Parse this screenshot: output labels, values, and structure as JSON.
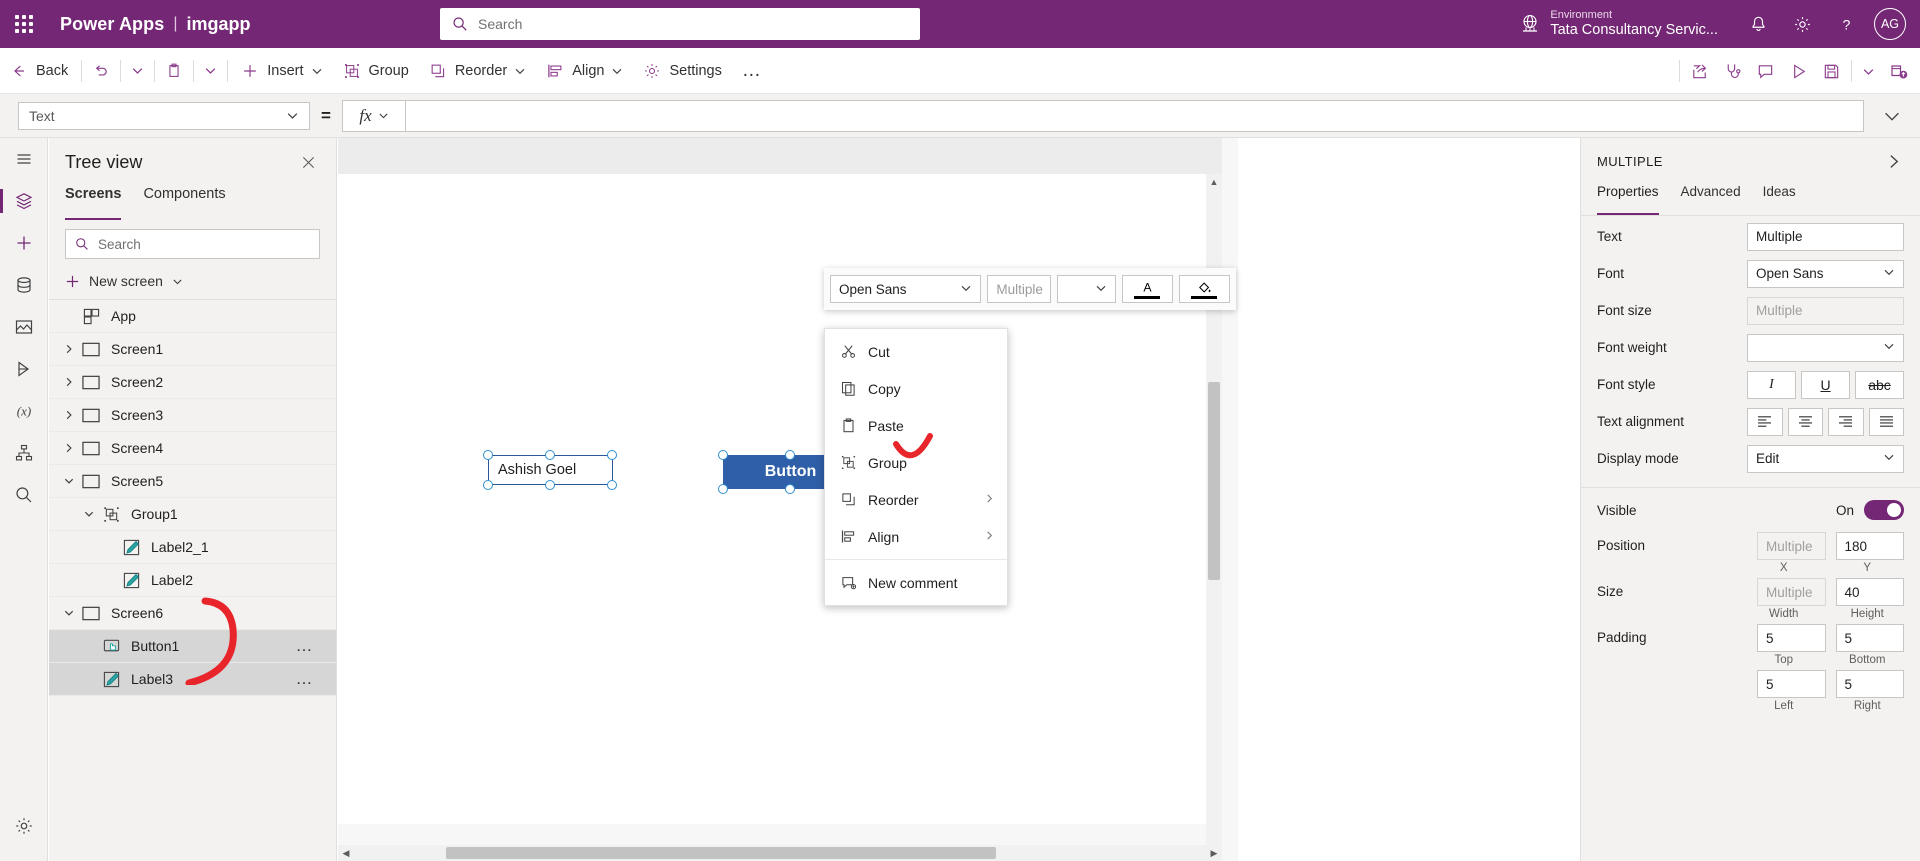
{
  "brand": {
    "waffle_icon": "waffle-icon",
    "product": "Power Apps",
    "separator": "|",
    "app_name": "imgapp",
    "search_placeholder": "Search",
    "environment_label": "Environment",
    "environment_name": "Tata Consultancy Servic...",
    "notification_icon": "bell-icon",
    "settings_icon": "gear-icon",
    "help_icon": "question-icon",
    "avatar_initials": "AG"
  },
  "commandbar": {
    "back": "Back",
    "undo_icon": "undo-icon",
    "undo_chevron": "chevron-down-icon",
    "paste_icon": "clipboard-icon",
    "paste_chevron": "chevron-down-icon",
    "insert": "Insert",
    "group": "Group",
    "reorder": "Reorder",
    "align": "Align",
    "settings": "Settings",
    "overflow": "…",
    "right_icons": [
      "share-icon",
      "app-checker-icon",
      "comments-icon",
      "play-icon",
      "save-icon",
      "chevron-down-icon",
      "publish-icon"
    ]
  },
  "formulabar": {
    "property": "Text",
    "equals": "=",
    "fx_label": "fx",
    "fx_chevron": "chevron-down-icon",
    "formula_value": "",
    "expand_icon": "chevron-down-icon"
  },
  "rail": {
    "items": [
      "menu-icon",
      "layers-icon",
      "insert-icon",
      "data-icon",
      "media-icon",
      "flows-icon",
      "variables-icon",
      "tree-icon",
      "search-icon"
    ],
    "bottom_items": [
      "settings-gear-icon"
    ]
  },
  "treeview": {
    "title": "Tree view",
    "close_icon": "close-icon",
    "tabs": [
      {
        "label": "Screens",
        "active": true
      },
      {
        "label": "Components",
        "active": false
      }
    ],
    "search_placeholder": "Search",
    "search_icon": "search-icon",
    "new_screen": "New screen",
    "new_screen_chevron": "chevron-down-icon",
    "rows": [
      {
        "name": "App",
        "icon": "app-icon",
        "twisty": "",
        "indent": 0,
        "selected": false,
        "dots": false
      },
      {
        "name": "Screen1",
        "icon": "screen-icon",
        "twisty": "collapsed",
        "indent": 0,
        "selected": false,
        "dots": false
      },
      {
        "name": "Screen2",
        "icon": "screen-icon",
        "twisty": "collapsed",
        "indent": 0,
        "selected": false,
        "dots": false
      },
      {
        "name": "Screen3",
        "icon": "screen-icon",
        "twisty": "collapsed",
        "indent": 0,
        "selected": false,
        "dots": false
      },
      {
        "name": "Screen4",
        "icon": "screen-icon",
        "twisty": "collapsed",
        "indent": 0,
        "selected": false,
        "dots": false
      },
      {
        "name": "Screen5",
        "icon": "screen-icon",
        "twisty": "expanded",
        "indent": 0,
        "selected": false,
        "dots": false
      },
      {
        "name": "Group1",
        "icon": "group-icon",
        "twisty": "expanded",
        "indent": 1,
        "selected": false,
        "dots": false
      },
      {
        "name": "Label2_1",
        "icon": "label-icon",
        "twisty": "",
        "indent": 2,
        "selected": false,
        "dots": false
      },
      {
        "name": "Label2",
        "icon": "label-icon",
        "twisty": "",
        "indent": 2,
        "selected": false,
        "dots": false
      },
      {
        "name": "Screen6",
        "icon": "screen-icon",
        "twisty": "expanded",
        "indent": 0,
        "selected": false,
        "dots": false
      },
      {
        "name": "Button1",
        "icon": "button-icon",
        "twisty": "",
        "indent": 1,
        "selected": true,
        "dots": true
      },
      {
        "name": "Label3",
        "icon": "label-icon",
        "twisty": "",
        "indent": 1,
        "selected": true,
        "dots": true
      }
    ]
  },
  "canvas": {
    "label_control_text": "Ashish Goel",
    "button_control_text": "Button",
    "scroll_up_icon": "caret-up-icon",
    "scroll_down_icon": "caret-down-icon",
    "scroll_left_icon": "caret-left-icon",
    "scroll_right_icon": "caret-right-icon"
  },
  "mini_toolbar": {
    "font_value": "Open Sans",
    "font_chevron": "chevron-down-icon",
    "size_placeholder": "Multiple",
    "size_value": "",
    "weight_value": "",
    "weight_chevron": "chevron-down-icon",
    "font_color_icon": "font-color-icon",
    "fill_color_icon": "fill-color-icon"
  },
  "context_menu": {
    "items": [
      {
        "label": "Cut",
        "icon": "scissors-icon",
        "submenu": false
      },
      {
        "label": "Copy",
        "icon": "copy-icon",
        "submenu": false
      },
      {
        "label": "Paste",
        "icon": "clipboard-icon",
        "submenu": false
      },
      {
        "label": "Group",
        "icon": "group-icon",
        "submenu": false
      },
      {
        "label": "Reorder",
        "icon": "reorder-icon",
        "submenu": true
      },
      {
        "label": "Align",
        "icon": "align-icon",
        "submenu": true
      },
      {
        "label": "New comment",
        "icon": "comment-icon",
        "submenu": false
      }
    ]
  },
  "properties": {
    "header": "MULTIPLE",
    "collapse_icon": "chevron-right-icon",
    "tabs": [
      {
        "label": "Properties",
        "active": true
      },
      {
        "label": "Advanced",
        "active": false
      },
      {
        "label": "Ideas",
        "active": false
      }
    ],
    "text_label": "Text",
    "text_value": "Multiple",
    "font_label": "Font",
    "font_value": "Open Sans",
    "font_size_label": "Font size",
    "font_size_placeholder": "Multiple",
    "font_size_value": "",
    "font_weight_label": "Font weight",
    "font_weight_value": "",
    "font_style_label": "Font style",
    "font_style_buttons": [
      "italic-icon",
      "underline-icon",
      "strikethrough-icon"
    ],
    "text_alignment_label": "Text alignment",
    "text_alignment_buttons": [
      "align-left-icon",
      "align-center-icon",
      "align-right-icon",
      "align-justify-icon"
    ],
    "display_mode_label": "Display mode",
    "display_mode_value": "Edit",
    "visible_label": "Visible",
    "visible_state": "On",
    "position_label": "Position",
    "position_x_placeholder": "Multiple",
    "position_x_value": "",
    "position_y_value": "180",
    "position_cap_x": "X",
    "position_cap_y": "Y",
    "size_label": "Size",
    "size_w_placeholder": "Multiple",
    "size_w_value": "",
    "size_h_value": "40",
    "size_cap_w": "Width",
    "size_cap_h": "Height",
    "padding_label": "Padding",
    "padding_top": "5",
    "padding_bottom": "5",
    "padding_cap_top": "Top",
    "padding_cap_bottom": "Bottom",
    "padding_left": "5",
    "padding_right": "5",
    "padding_cap_left": "Left",
    "padding_cap_right": "Right"
  },
  "colors": {
    "brand_purple": "#742774",
    "accent_purple": "#8c3b8c",
    "button_blue": "#2f5fa8",
    "annotation_red": "#e8252a"
  }
}
